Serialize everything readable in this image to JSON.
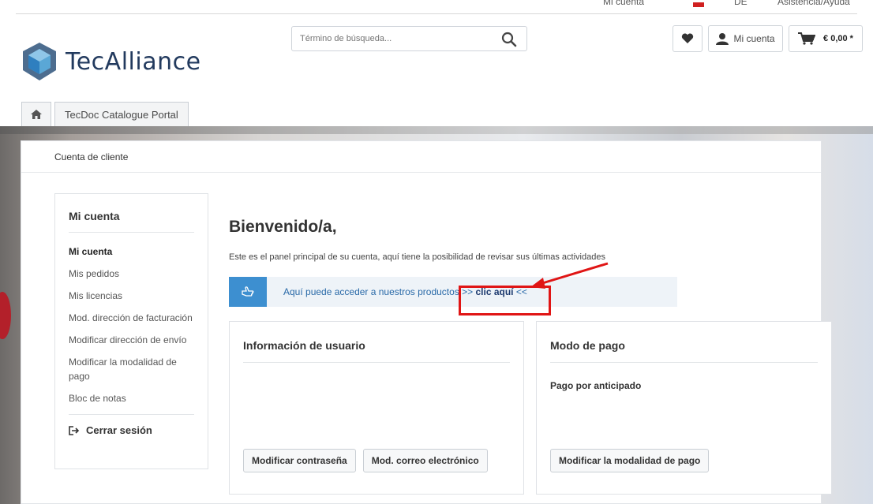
{
  "topbar": {
    "account": "Mi cuenta",
    "lang": "DE",
    "help": "Asistencia/Ayuda"
  },
  "brand": {
    "name": "TecAlliance"
  },
  "search": {
    "placeholder": "Término de búsqueda..."
  },
  "header": {
    "account_label": "Mi cuenta",
    "cart_total": "€ 0,00 *"
  },
  "nav": {
    "portal_tab": "TecDoc Catalogue Portal"
  },
  "breadcrumb": "Cuenta de cliente",
  "sidebar": {
    "title": "Mi cuenta",
    "items": [
      {
        "label": "Mi cuenta"
      },
      {
        "label": "Mis pedidos"
      },
      {
        "label": "Mis licencias"
      },
      {
        "label": "Mod. dirección de facturación"
      },
      {
        "label": "Modificar dirección de envío"
      },
      {
        "label": "Modificar la modalidad de pago"
      },
      {
        "label": "Bloc de notas"
      }
    ],
    "logout": "Cerrar sesión"
  },
  "main": {
    "welcome": "Bienvenido/a,",
    "intro": "Este es el panel principal de su cuenta, aquí tiene la posibilidad de revisar sus últimas actividades",
    "info_text": "Aquí puede acceder a nuestros productos >> ",
    "info_link": "clic aquí",
    "info_suffix": " <<"
  },
  "user_card": {
    "title": "Información de usuario",
    "btn_password": "Modificar contraseña",
    "btn_email": "Mod. correo electrónico"
  },
  "payment_card": {
    "title": "Modo de pago",
    "method": "Pago por anticipado",
    "btn_change": "Modificar la modalidad de pago"
  },
  "colors": {
    "accent": "#3d8fd0",
    "brand_text": "#223a5e",
    "annotation": "#e01515"
  }
}
